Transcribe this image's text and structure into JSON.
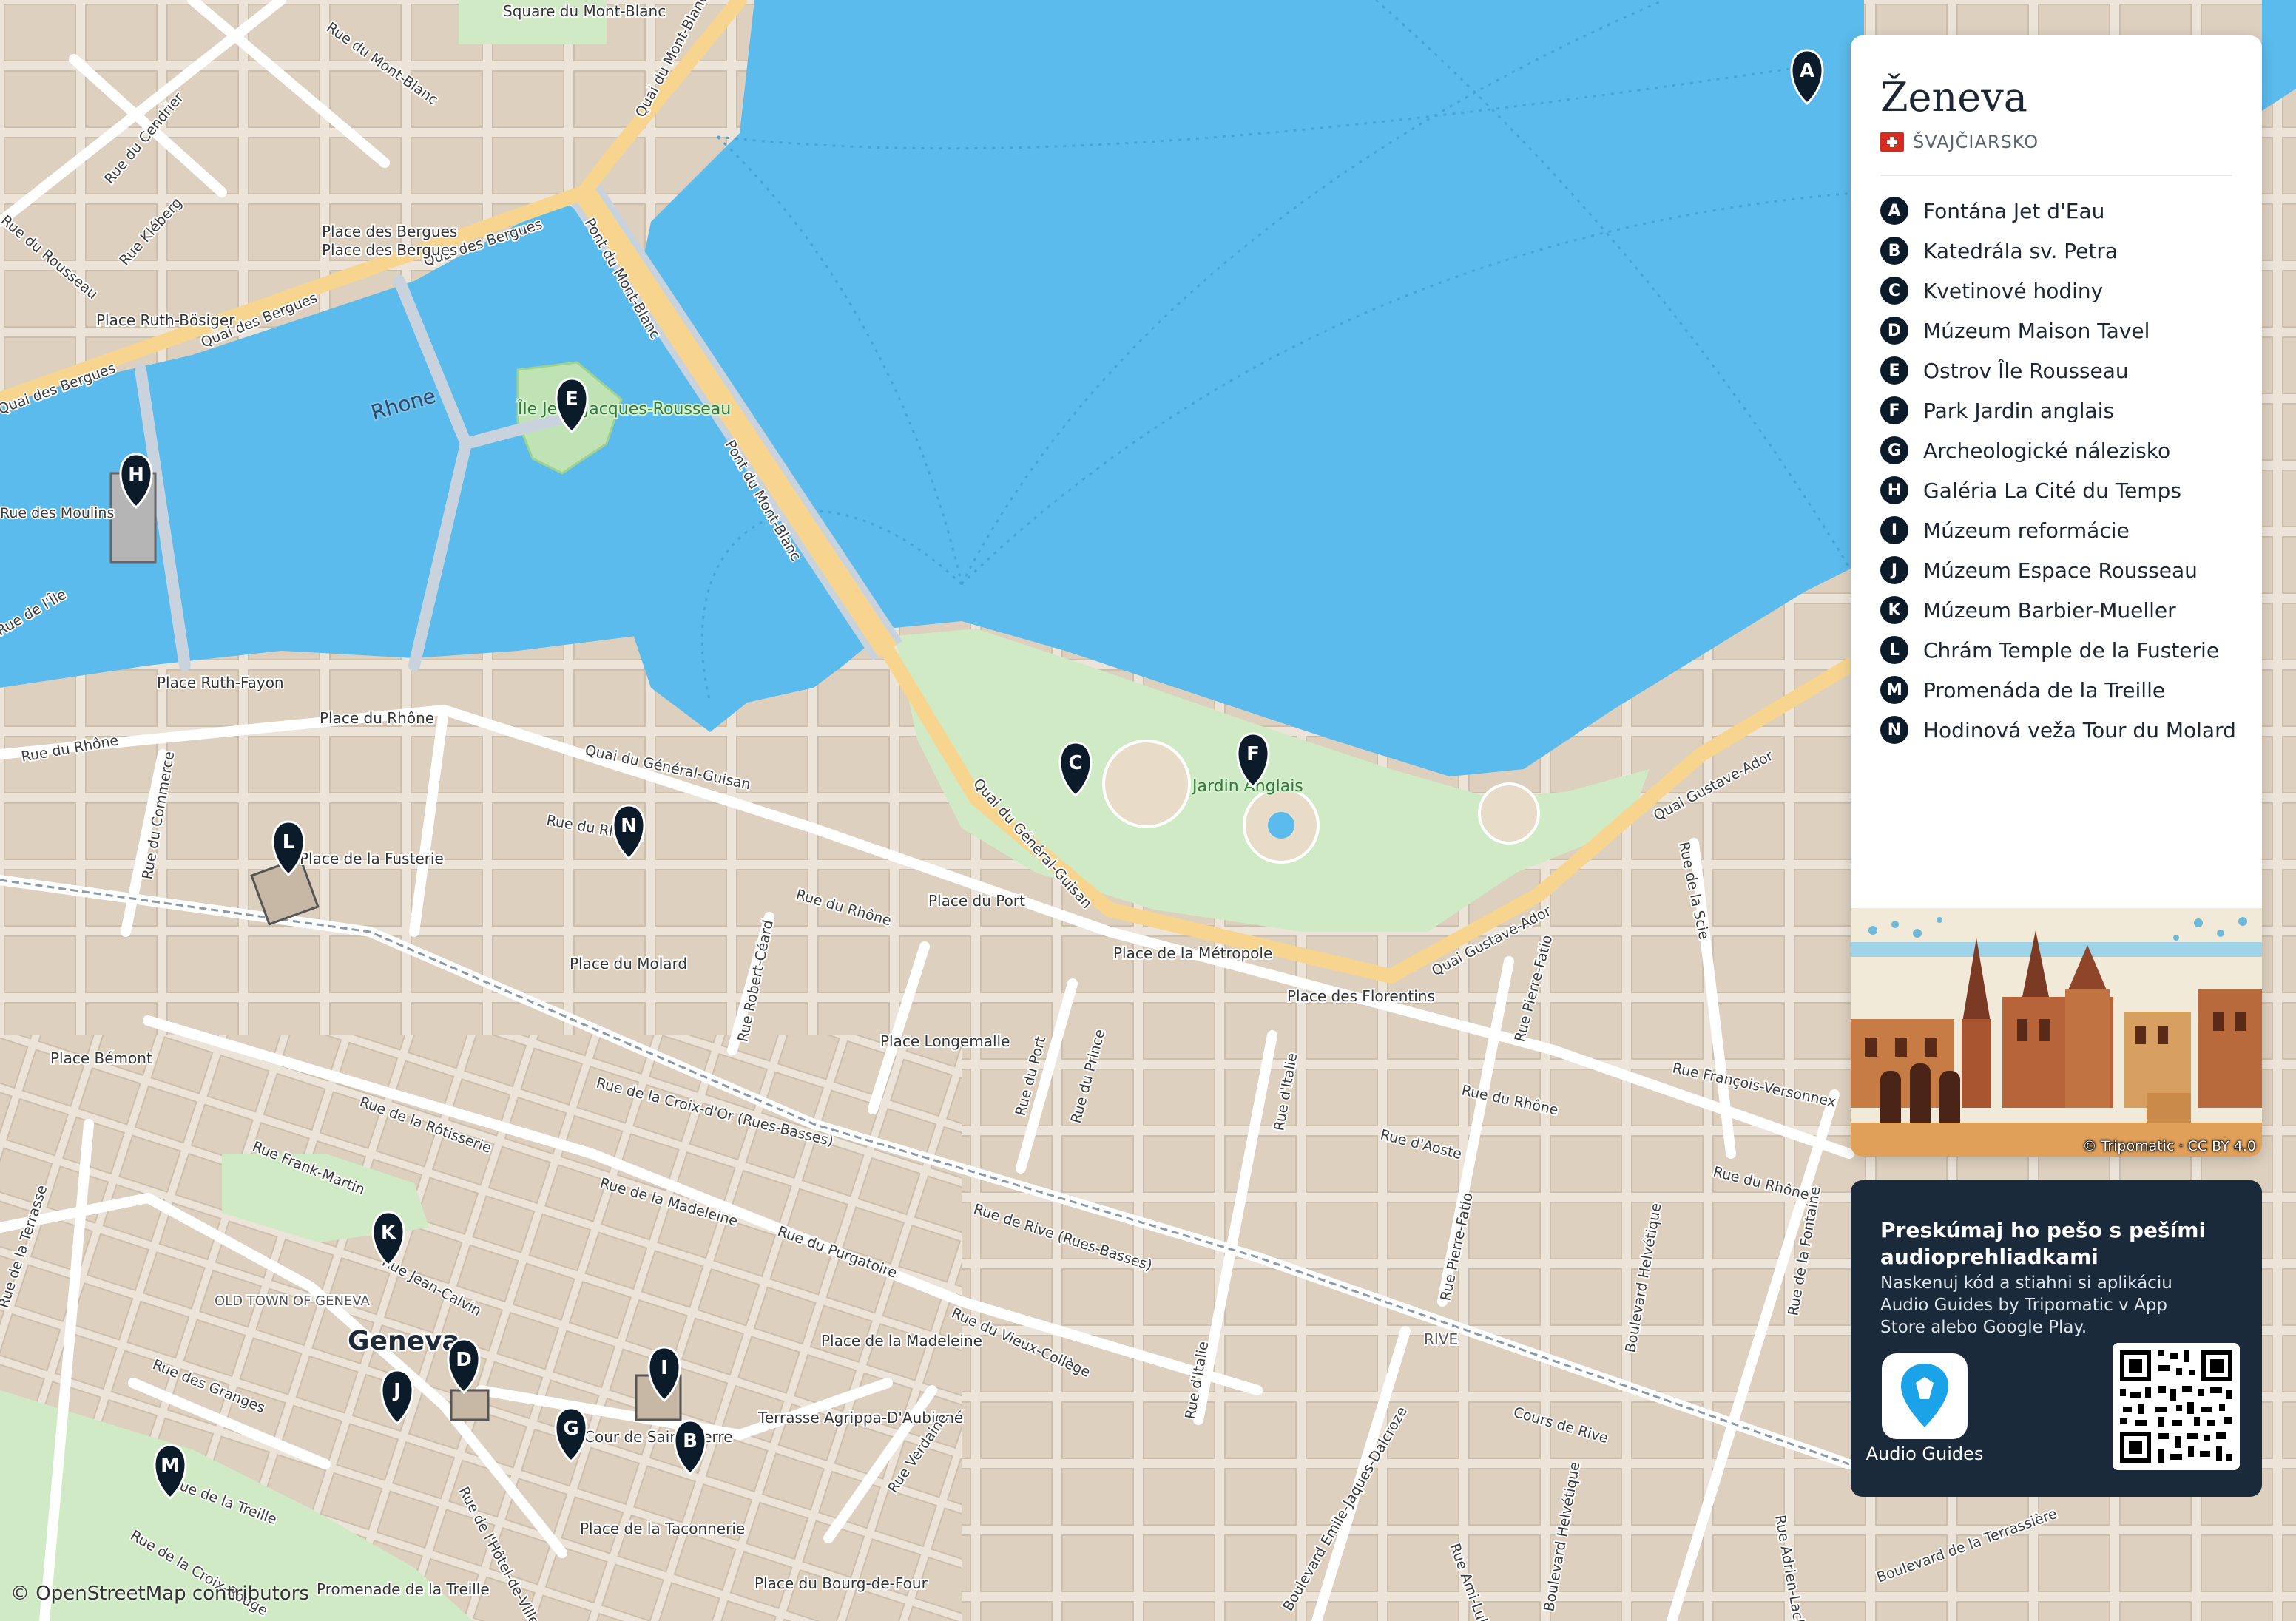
{
  "map": {
    "colors": {
      "water": "#5bbbec",
      "land": "#ece4d8",
      "block": "#ddd0bf",
      "park": "#cfeac4",
      "road_major": "#f7d58f",
      "road_minor": "#ffffff",
      "pin": "#0c1b2a"
    },
    "streets": [
      "Rue du Mont-Blanc",
      "Quai du Mont-Blanc",
      "Rue du Cendrier",
      "Rue Kléberg",
      "Rue du Rousseau",
      "Place des Bergues",
      "Quai des Bergues",
      "Place Ruth-Bösiger",
      "Quai des Bergues",
      "Quai des Bergues",
      "Pont du Mont-Blanc",
      "Pont du Mont-Blanc",
      "Place Ruth-Fayon",
      "Place du Rhône",
      "Rue du Rhône",
      "Quai du Général-Guisan",
      "Rue du Rhône",
      "Rue du Commerce",
      "Rue du Rhône",
      "Place du Port",
      "Quai du Général-Guisan",
      "Place du Molard",
      "Rue Robert-Céard",
      "Place de la Métropole",
      "Place Longemalle",
      "Place des Florentins",
      "Quai Gustave-Ador",
      "Rue Pierre-Fatio",
      "Rue de la Scie",
      "Quai Gustave-Ador",
      "Rue François-Versonnex",
      "Rue du Port",
      "Rue du Prince",
      "Rue d'Italie",
      "Rue du Rhône",
      "Rue d'Aoste",
      "Place Bémont",
      "Rue de la Croix-d'Or (Rues-Basses)",
      "Rue de la Rôtisserie",
      "Rue Frank-Martin",
      "Rue de la Madeleine",
      "Rue du Purgatoire",
      "Rue de Rive (Rues-Basses)",
      "Rue du Rhône",
      "Rue du Vieux-Collège",
      "Place de la Madeleine",
      "Rue Pierre-Fatio",
      "Boulevard Helvétique",
      "Rue de la Terrasse",
      "Rue des Granges",
      "Rue Jean-Calvin",
      "Terrasse Agrippa-D'Aubigné",
      "Cours de Rive",
      "Rue Verdaine",
      "Rue d'Italie",
      "Boulevard Emile-Jaques-Dalcroze",
      "Rue Ami-Lullin",
      "Boulevard Helvétique",
      "Rue de l'Hôtel-de-Ville",
      "Rue de la Croix-Rouge",
      "Place de la Taconnerie",
      "Place du Bourg-de-Four",
      "Promenade de la Treille",
      "Rue de la Treille",
      "Boulevard de la Terrassière",
      "Rue Adrien-Lachenal",
      "Rue de l'Île",
      "Rue des Moulins",
      "Rue de la Fontaine"
    ],
    "places": [
      "Square du Mont-Blanc",
      "Place des Bergues",
      "OLD TOWN OF GENEVA",
      "Geneva",
      "RIVE",
      "Cour de Saint-Pierre",
      "Place de la Fusterie"
    ],
    "water_labels": [
      "Rhone"
    ],
    "park_labels": [
      "Île Jean-Jacques-Rousseau",
      "Jardin Anglais"
    ]
  },
  "pins": [
    "A",
    "B",
    "C",
    "D",
    "E",
    "F",
    "G",
    "H",
    "I",
    "J",
    "K",
    "L",
    "M",
    "N"
  ],
  "panel": {
    "title": "Ženeva",
    "country": "ŠVAJČIARSKO",
    "flag_icon": "swiss-flag-icon",
    "pois": [
      {
        "letter": "A",
        "name": "Fontána Jet d'Eau"
      },
      {
        "letter": "B",
        "name": "Katedrála sv. Petra"
      },
      {
        "letter": "C",
        "name": "Kvetinové hodiny"
      },
      {
        "letter": "D",
        "name": "Múzeum Maison Tavel"
      },
      {
        "letter": "E",
        "name": "Ostrov Île Rousseau"
      },
      {
        "letter": "F",
        "name": "Park Jardin anglais"
      },
      {
        "letter": "G",
        "name": "Archeologické nálezisko"
      },
      {
        "letter": "H",
        "name": "Galéria La Cité du Temps"
      },
      {
        "letter": "I",
        "name": "Múzeum reformácie"
      },
      {
        "letter": "J",
        "name": "Múzeum Espace Rousseau"
      },
      {
        "letter": "K",
        "name": "Múzeum Barbier-Mueller"
      },
      {
        "letter": "L",
        "name": "Chrám Temple de la Fusterie"
      },
      {
        "letter": "M",
        "name": "Promenáda de la Treille"
      },
      {
        "letter": "N",
        "name": "Hodinová veža Tour du Molard"
      }
    ],
    "illustration_credit": "© Tripomatic · CC BY 4.0"
  },
  "promo": {
    "heading": "Preskúmaj ho pešo s pešími audioprehliadkami",
    "body": "Naskenuj kód a stiahni si aplikáciu Audio Guides by Tripomatic v App Store alebo Google Play.",
    "app_label": "Audio Guides",
    "app_icon": "audio-guides-pin-icon",
    "qr_icon": "qr-code-icon"
  },
  "attribution": "© OpenStreetMap contributors"
}
